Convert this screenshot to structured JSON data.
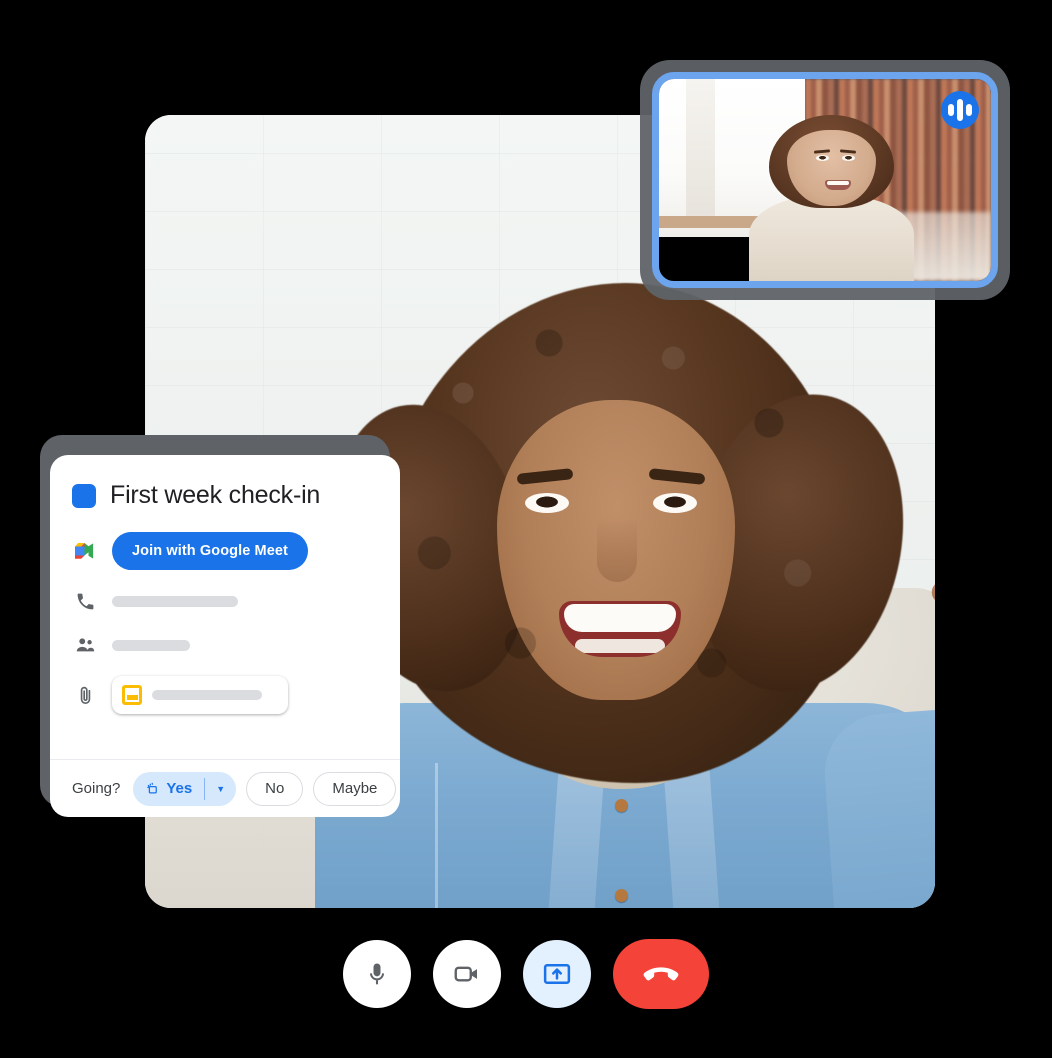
{
  "app": {
    "name": "Google Meet video call"
  },
  "main_video": {
    "participant": "smiling woman with curly hair waving",
    "alt": "main-speaker-video-tile"
  },
  "pip": {
    "participant": "woman in front of bookshelf",
    "alt": "self-view-video-tile",
    "badge_icon": "audio-waveform-icon",
    "border_color": "#6ca4ee"
  },
  "calendar_card": {
    "color_chip": "#1a73e8",
    "title": "First week check-in",
    "meet_button": {
      "label": "Join with Google Meet",
      "icon": "google-meet-icon",
      "color": "#1a73e8"
    },
    "rows": [
      {
        "icon": "phone-icon",
        "value": ""
      },
      {
        "icon": "people-icon",
        "value": ""
      }
    ],
    "attachment": {
      "icon": "paperclip-icon",
      "file_icon": "google-slides-icon",
      "file_name": ""
    },
    "rsvp": {
      "label": "Going?",
      "yes": {
        "label": "Yes",
        "icon": "add-to-tasks-icon",
        "selected": true,
        "caret": "▼"
      },
      "no": {
        "label": "No",
        "selected": false
      },
      "maybe": {
        "label": "Maybe",
        "selected": false
      }
    }
  },
  "controls": [
    {
      "name": "microphone-button",
      "icon": "microphone-icon",
      "state": "on",
      "bg": "#ffffff"
    },
    {
      "name": "camera-button",
      "icon": "video-camera-icon",
      "state": "on",
      "bg": "#ffffff"
    },
    {
      "name": "present-screen-button",
      "icon": "present-screen-icon",
      "state": "active",
      "bg": "#e3f0fd"
    },
    {
      "name": "end-call-button",
      "icon": "end-call-icon",
      "state": "default",
      "bg": "#f4443a"
    }
  ]
}
